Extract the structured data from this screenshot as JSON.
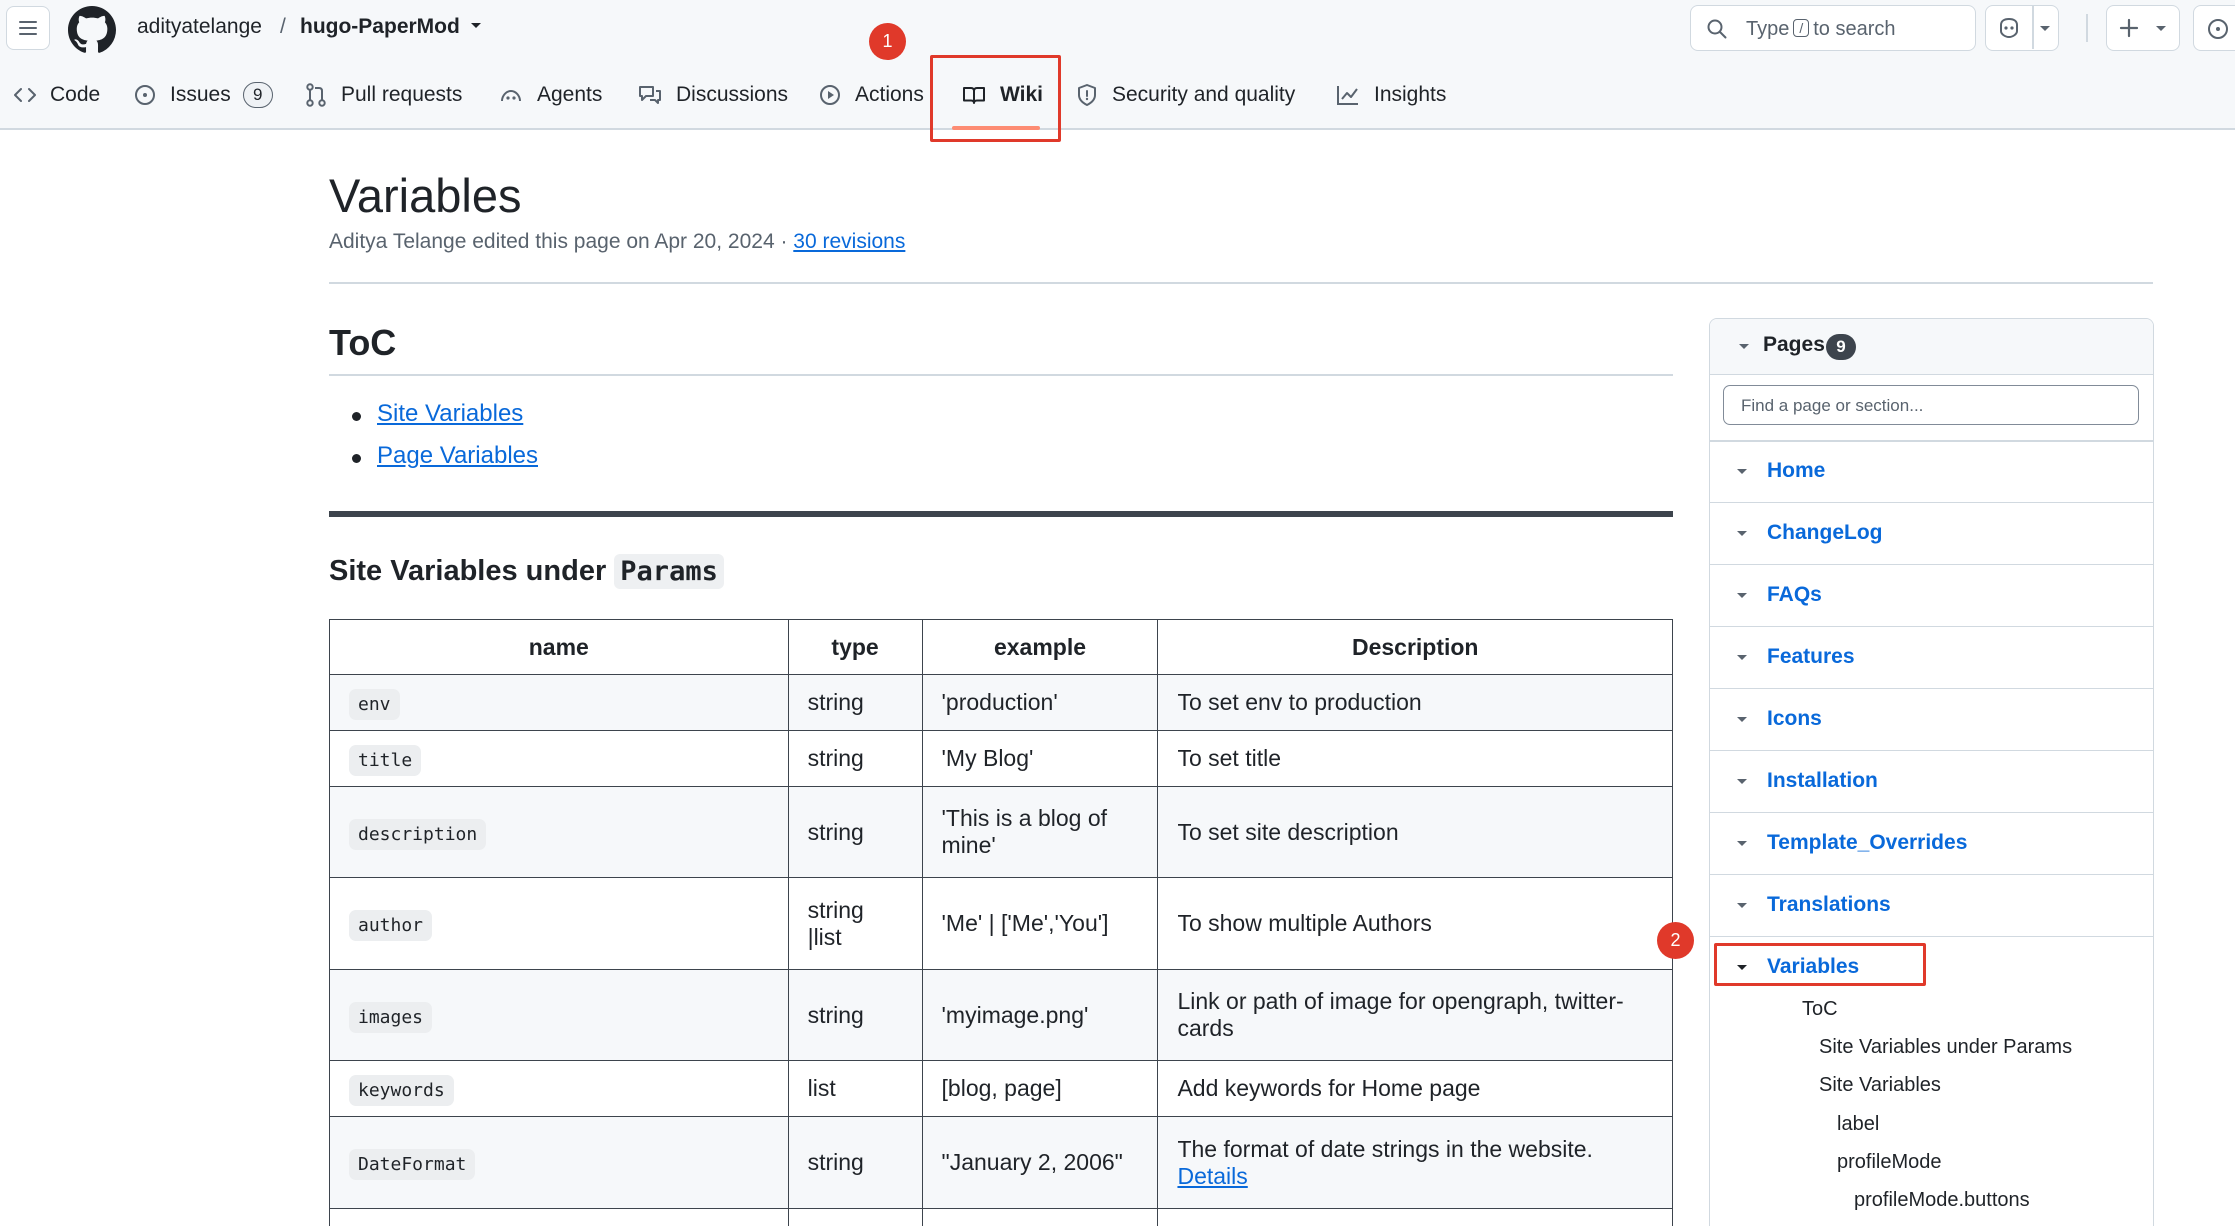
{
  "header": {
    "owner": "adityatelange",
    "separator": "/",
    "repo": "hugo-PaperMod",
    "search_prefix": "Type",
    "search_key": "/",
    "search_suffix": "to search"
  },
  "tabs": [
    {
      "label": "Code",
      "icon": "code-icon"
    },
    {
      "label": "Issues",
      "count": "9",
      "icon": "issue-icon"
    },
    {
      "label": "Pull requests",
      "icon": "pull-request-icon"
    },
    {
      "label": "Agents",
      "icon": "agents-icon"
    },
    {
      "label": "Discussions",
      "icon": "discussions-icon"
    },
    {
      "label": "Actions",
      "icon": "play-icon"
    },
    {
      "label": "Wiki",
      "icon": "book-icon",
      "active": true
    },
    {
      "label": "Security and quality",
      "icon": "shield-icon"
    },
    {
      "label": "Insights",
      "icon": "graph-icon"
    }
  ],
  "annotations": {
    "badge1": "1",
    "badge2": "2",
    "color": "#e0392a"
  },
  "page": {
    "title": "Variables",
    "meta": "Aditya Telange edited this page on Apr 20, 2024 · ",
    "revisions": "30 revisions"
  },
  "content": {
    "toc_heading": "ToC",
    "toc": [
      "Site Variables",
      "Page Variables"
    ],
    "section_heading": "Site Variables under ",
    "section_code": "Params",
    "table": {
      "headers": [
        "name",
        "type",
        "example",
        "Description"
      ],
      "rows": [
        {
          "name": "env",
          "type": "string",
          "example": "'production'",
          "desc": "To set env to production"
        },
        {
          "name": "title",
          "type": "string",
          "example": "'My Blog'",
          "desc": "To set title"
        },
        {
          "name": "description",
          "type": "string",
          "example": "'This is a blog of mine'",
          "desc": "To set site description"
        },
        {
          "name": "author",
          "type": "string |list",
          "example": "'Me' | ['Me','You']",
          "desc": "To show multiple Authors"
        },
        {
          "name": "images",
          "type": "string",
          "example": "'myimage.png'",
          "desc": "Link or path of image for opengraph, twitter-cards"
        },
        {
          "name": "keywords",
          "type": "list",
          "example": "[blog, page]",
          "desc": "Add keywords for Home page"
        },
        {
          "name": "DateFormat",
          "type": "string",
          "example": "\"January 2, 2006\"",
          "desc": "The format of date strings in the website.",
          "link": "Details"
        }
      ]
    }
  },
  "sidebar": {
    "title": "Pages",
    "count": "9",
    "search_placeholder": "Find a page or section...",
    "pages": [
      "Home",
      "ChangeLog",
      "FAQs",
      "Features",
      "Icons",
      "Installation",
      "Template_Overrides",
      "Translations",
      "Variables"
    ],
    "subsections": [
      "ToC",
      "Site Variables under Params",
      "Site Variables",
      "label",
      "profileMode",
      "profileMode.buttons"
    ]
  },
  "colors": {
    "link": "#0969da",
    "text": "#1f2328",
    "muted": "#59636e",
    "border": "#d1d9e0",
    "underline": "#fd8c73"
  }
}
